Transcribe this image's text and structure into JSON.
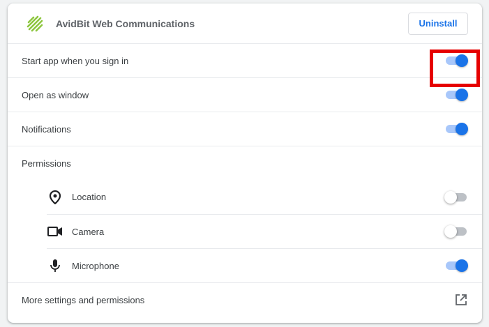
{
  "header": {
    "app_name": "AvidBit Web Communications",
    "uninstall_label": "Uninstall",
    "app_icon": "striped-leaf-logo",
    "accent": "#8dc63f"
  },
  "settings": [
    {
      "label": "Start app when you sign in",
      "enabled": true
    },
    {
      "label": "Open as window",
      "enabled": true
    },
    {
      "label": "Notifications",
      "enabled": true
    }
  ],
  "permissions": {
    "title": "Permissions",
    "items": [
      {
        "label": "Location",
        "icon": "location-pin-icon",
        "enabled": false
      },
      {
        "label": "Camera",
        "icon": "camera-icon",
        "enabled": false
      },
      {
        "label": "Microphone",
        "icon": "microphone-icon",
        "enabled": true
      }
    ]
  },
  "more": {
    "label": "More settings and permissions",
    "icon": "open-external-icon"
  },
  "colors": {
    "toggle_on": "#1a73e8",
    "toggle_track_on": "#a8c7fa",
    "highlight": "#e60000"
  }
}
